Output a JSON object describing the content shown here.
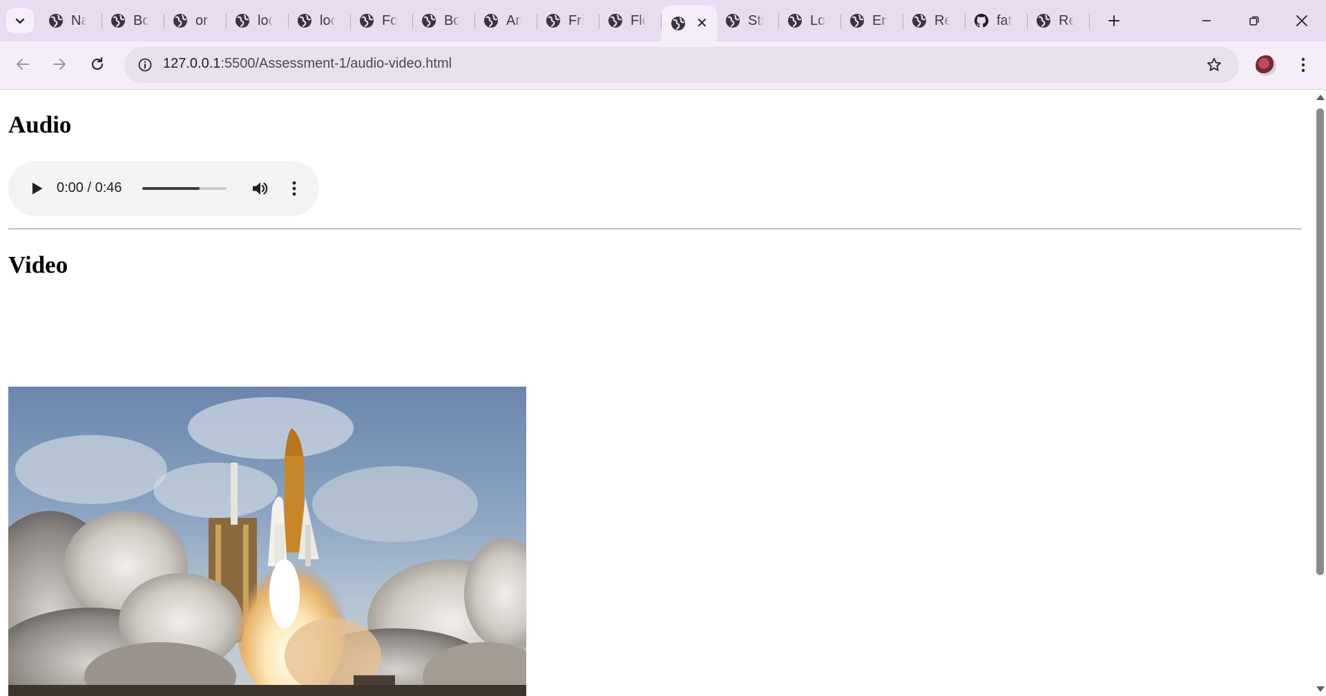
{
  "browser": {
    "tabs": [
      {
        "title": "Na",
        "icon": "globe-icon"
      },
      {
        "title": "Bo",
        "icon": "globe-icon"
      },
      {
        "title": "or",
        "icon": "globe-icon"
      },
      {
        "title": "loc",
        "icon": "globe-icon"
      },
      {
        "title": "loc",
        "icon": "globe-icon"
      },
      {
        "title": "Fo",
        "icon": "globe-icon"
      },
      {
        "title": "Bo",
        "icon": "globe-icon"
      },
      {
        "title": "An",
        "icon": "globe-icon"
      },
      {
        "title": "Fri",
        "icon": "globe-icon"
      },
      {
        "title": "Fle",
        "icon": "globe-icon"
      },
      {
        "title": "",
        "icon": "globe-icon",
        "active": true,
        "close_label": "✕"
      },
      {
        "title": "Sti",
        "icon": "globe-icon"
      },
      {
        "title": "Lo",
        "icon": "globe-icon"
      },
      {
        "title": "Err",
        "icon": "globe-icon"
      },
      {
        "title": "Re",
        "icon": "globe-icon"
      },
      {
        "title": "fat",
        "icon": "github-icon"
      },
      {
        "title": "Re",
        "icon": "globe-icon"
      }
    ],
    "address": {
      "host": "127.0.0.1",
      "path": ":5500/Assessment-1/audio-video.html"
    },
    "colors": {
      "tabstrip": "#e9dcf0",
      "toolbar": "#f5eef9",
      "omnibox": "#e9e0ee"
    }
  },
  "page": {
    "audio_heading": "Audio",
    "audio_player": {
      "time": "0:00 / 0:46",
      "seek_fraction": 0.68
    },
    "video_heading": "Video",
    "video_poster": "rocket-launch-image"
  }
}
